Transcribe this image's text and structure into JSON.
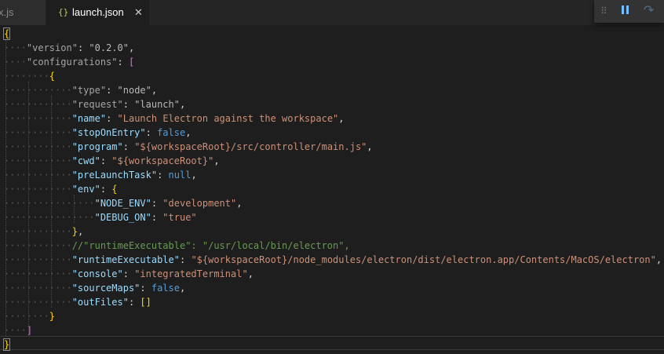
{
  "tabs": {
    "previous": {
      "label": "x.js"
    },
    "active": {
      "icon": "{}",
      "label": "launch.json",
      "close": "✕"
    }
  },
  "debug_toolbar": {
    "grip": "⠿",
    "restart": "↷"
  },
  "lines": [
    [
      [
        "br-box",
        "{"
      ]
    ],
    [
      [
        "ws",
        "····"
      ],
      [
        "kdim",
        "\"version\""
      ],
      [
        "p",
        ": "
      ],
      [
        "sdim",
        "\"0.2.0\""
      ],
      [
        "p",
        ","
      ]
    ],
    [
      [
        "ws",
        "····"
      ],
      [
        "kdim",
        "\"configurations\""
      ],
      [
        "p",
        ": "
      ],
      [
        "br-m",
        "["
      ]
    ],
    [
      [
        "ws",
        "········"
      ],
      [
        "br-y",
        "{"
      ]
    ],
    [
      [
        "ws",
        "············"
      ],
      [
        "kdim",
        "\"type\""
      ],
      [
        "p",
        ": "
      ],
      [
        "sdim",
        "\"node\""
      ],
      [
        "p",
        ","
      ]
    ],
    [
      [
        "ws",
        "············"
      ],
      [
        "kdim",
        "\"request\""
      ],
      [
        "p",
        ": "
      ],
      [
        "sdim",
        "\"launch\""
      ],
      [
        "p",
        ","
      ]
    ],
    [
      [
        "ws",
        "············"
      ],
      [
        "k",
        "\"name\""
      ],
      [
        "p",
        ": "
      ],
      [
        "s",
        "\"Launch Electron against the workspace\""
      ],
      [
        "p",
        ","
      ]
    ],
    [
      [
        "ws",
        "············"
      ],
      [
        "k",
        "\"stopOnEntry\""
      ],
      [
        "p",
        ": "
      ],
      [
        "b",
        "false"
      ],
      [
        "p",
        ","
      ]
    ],
    [
      [
        "ws",
        "············"
      ],
      [
        "k",
        "\"program\""
      ],
      [
        "p",
        ": "
      ],
      [
        "s",
        "\"${workspaceRoot}/src/controller/main.js\""
      ],
      [
        "p",
        ","
      ]
    ],
    [
      [
        "ws",
        "············"
      ],
      [
        "k",
        "\"cwd\""
      ],
      [
        "p",
        ": "
      ],
      [
        "s",
        "\"${workspaceRoot}\""
      ],
      [
        "p",
        ","
      ]
    ],
    [
      [
        "ws",
        "············"
      ],
      [
        "k",
        "\"preLaunchTask\""
      ],
      [
        "p",
        ": "
      ],
      [
        "b",
        "null"
      ],
      [
        "p",
        ","
      ]
    ],
    [
      [
        "ws",
        "············"
      ],
      [
        "k",
        "\"env\""
      ],
      [
        "p",
        ": "
      ],
      [
        "br-y",
        "{"
      ]
    ],
    [
      [
        "ws",
        "················"
      ],
      [
        "k",
        "\"NODE_ENV\""
      ],
      [
        "p",
        ": "
      ],
      [
        "s",
        "\"development\""
      ],
      [
        "p",
        ","
      ]
    ],
    [
      [
        "ws",
        "················"
      ],
      [
        "k",
        "\"DEBUG_ON\""
      ],
      [
        "p",
        ": "
      ],
      [
        "s",
        "\"true\""
      ]
    ],
    [
      [
        "ws",
        "············"
      ],
      [
        "br-y",
        "}"
      ],
      [
        "p",
        ","
      ]
    ],
    [
      [
        "ws",
        "············"
      ],
      [
        "c",
        "//\"runtimeExecutable\": \"/usr/local/bin/electron\","
      ]
    ],
    [
      [
        "ws",
        "············"
      ],
      [
        "k",
        "\"runtimeExecutable\""
      ],
      [
        "p",
        ": "
      ],
      [
        "s",
        "\"${workspaceRoot}/node_modules/electron/dist/electron.app/Contents/MacOS/electron\""
      ],
      [
        "p",
        ","
      ]
    ],
    [
      [
        "ws",
        "············"
      ],
      [
        "k",
        "\"console\""
      ],
      [
        "p",
        ": "
      ],
      [
        "s",
        "\"integratedTerminal\""
      ],
      [
        "p",
        ","
      ]
    ],
    [
      [
        "ws",
        "············"
      ],
      [
        "k",
        "\"sourceMaps\""
      ],
      [
        "p",
        ": "
      ],
      [
        "b",
        "false"
      ],
      [
        "p",
        ","
      ]
    ],
    [
      [
        "ws",
        "············"
      ],
      [
        "k",
        "\"outFiles\""
      ],
      [
        "p",
        ": "
      ],
      [
        "br-y",
        "[]"
      ]
    ],
    [
      [
        "ws",
        "········"
      ],
      [
        "br-y",
        "}"
      ]
    ],
    [
      [
        "ws",
        "····"
      ],
      [
        "br-m",
        "]"
      ]
    ],
    [
      [
        "br-box",
        "}"
      ]
    ]
  ]
}
